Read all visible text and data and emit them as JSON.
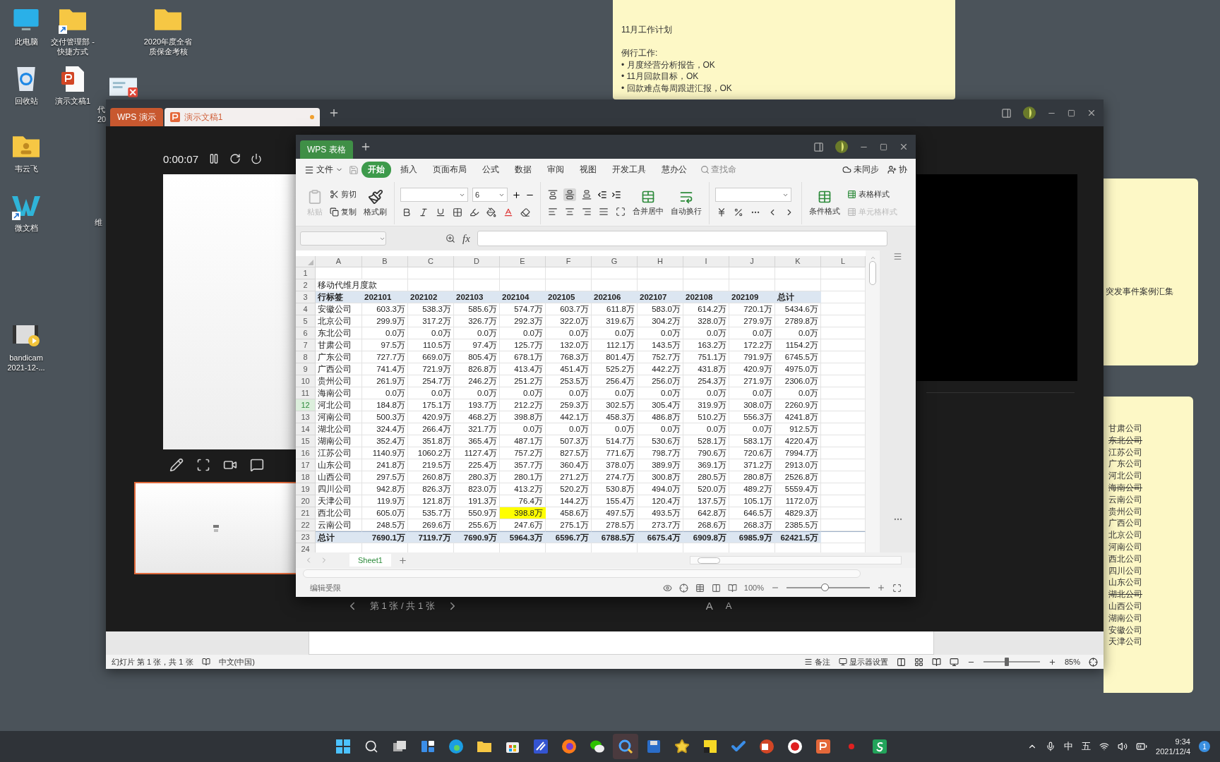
{
  "desktop_icons": [
    {
      "label": "此电脑",
      "kind": "monitor",
      "shortcut": false
    },
    {
      "label": "交付管理部 - 快捷方式",
      "kind": "folder",
      "shortcut": true
    },
    {
      "label": "2020年度全省质保金考核",
      "kind": "folder",
      "shortcut": false
    },
    {
      "label": "回收站",
      "kind": "recycle",
      "shortcut": false
    },
    {
      "label": "演示文稿1",
      "kind": "slides",
      "shortcut": false
    },
    {
      "label": "代\n20",
      "kind": "image",
      "shortcut": false
    },
    {
      "label": "韦云飞",
      "kind": "user-folder",
      "shortcut": false
    },
    {
      "label": "微文档",
      "kind": "w-app",
      "shortcut": true
    },
    {
      "label": "维",
      "kind": "hidden",
      "shortcut": false
    },
    {
      "label": "bandicam 2021-12-...",
      "kind": "video",
      "shortcut": false
    }
  ],
  "sticky_notes": [
    {
      "kind": "plan",
      "title": "11月工作计划",
      "lines": [
        {
          "text": "例行工作:",
          "struck": false
        },
        {
          "text": "• 月度经营分析报告，OK",
          "struck": false
        },
        {
          "text": "• 11月回款目标，OK",
          "struck": false
        },
        {
          "text": "• 回款难点每周跟进汇报，OK",
          "struck": false
        }
      ]
    },
    {
      "kind": "side",
      "lines": [
        {
          "text": "突发事件案例汇集",
          "struck": false
        }
      ]
    },
    {
      "kind": "list",
      "lines": [
        {
          "text": "甘肃公司",
          "struck": false
        },
        {
          "text": "东北公司",
          "struck": true
        },
        {
          "text": "江苏公司",
          "struck": false
        },
        {
          "text": "广东公司",
          "struck": false
        },
        {
          "text": "河北公司",
          "struck": false
        },
        {
          "text": "海南公司",
          "struck": true
        },
        {
          "text": "云南公司",
          "struck": false
        },
        {
          "text": "贵州公司",
          "struck": false
        },
        {
          "text": "广西公司",
          "struck": false
        },
        {
          "text": "北京公司",
          "struck": false
        },
        {
          "text": "河南公司",
          "struck": false
        },
        {
          "text": "西北公司",
          "struck": false
        },
        {
          "text": "四川公司",
          "struck": false
        },
        {
          "text": "山东公司",
          "struck": false
        },
        {
          "text": "湖北公司",
          "struck": true
        },
        {
          "text": "山西公司",
          "struck": false
        },
        {
          "text": "湖南公司",
          "struck": false
        },
        {
          "text": "安徽公司",
          "struck": false
        },
        {
          "text": "天津公司",
          "struck": false
        }
      ]
    }
  ],
  "presentation_window": {
    "app_tab": "WPS 演示",
    "doc_tabs": [
      {
        "label": "演示文稿1",
        "selected": true,
        "unsaved": true
      }
    ],
    "timer": "0:00:07",
    "slide_nav": "第 1 张 / 共 1 张",
    "font_buttons": [
      "A",
      "A"
    ],
    "status_bar": {
      "slide_info": "幻灯片 第 1 张，共 1 张",
      "language": "中文(中国)",
      "notes": "备注",
      "display_settings": "显示器设置",
      "zoom": "85%",
      "zoom_level": {
        "level": 0.41
      }
    }
  },
  "spreadsheet_window": {
    "app_tab": "WPS 表格",
    "menu": [
      {
        "label": "开始",
        "selected": true
      },
      {
        "label": "插入",
        "selected": false
      },
      {
        "label": "页面布局",
        "selected": false
      },
      {
        "label": "公式",
        "selected": false
      },
      {
        "label": "数据",
        "selected": false
      },
      {
        "label": "审阅",
        "selected": false
      },
      {
        "label": "视图",
        "selected": false
      },
      {
        "label": "开发工具",
        "selected": false
      },
      {
        "label": "慧办公",
        "selected": false
      }
    ],
    "file_menu": "文件",
    "search": "查找命",
    "sync": "未同步",
    "collab": "协",
    "ribbon": {
      "paste": {
        "label": "粘贴",
        "disabled": true
      },
      "cut": "剪切",
      "copy": "复制",
      "format_painter": "格式刷",
      "font_size": "6",
      "merge": "合并居中",
      "wrap": "自动换行",
      "conditional": "条件格式",
      "table_style": "表格样式",
      "cell_style": {
        "label": "单元格样式",
        "disabled": true
      },
      "vertical_align": [
        {
          "kind": "top",
          "selected": false
        },
        {
          "kind": "middle",
          "selected": true
        },
        {
          "kind": "bottom",
          "selected": false
        }
      ]
    },
    "fx_label": "fx",
    "sheet": {
      "columns": [
        "A",
        "B",
        "C",
        "D",
        "E",
        "F",
        "G",
        "H",
        "I",
        "J",
        "K",
        "L"
      ],
      "rows": [
        {
          "number": "1",
          "kind": "empty",
          "selected": false
        },
        {
          "number": "2",
          "kind": "title",
          "selected": false,
          "cells": [
            "移动代维月度款"
          ]
        },
        {
          "number": "3",
          "kind": "header",
          "selected": false,
          "cells": [
            "行标签",
            "202101",
            "202102",
            "202103",
            "202104",
            "202105",
            "202106",
            "202107",
            "202108",
            "202109",
            "总计"
          ]
        },
        {
          "number": "4",
          "kind": "data",
          "selected": false,
          "cells": [
            "安徽公司",
            "603.3万",
            "538.3万",
            "585.6万",
            "574.7万",
            "603.7万",
            "611.8万",
            "583.0万",
            "614.2万",
            "720.1万",
            "5434.6万"
          ],
          "highlighted": [
            false,
            false,
            false,
            false,
            false,
            false,
            false,
            false,
            false,
            false,
            false
          ]
        },
        {
          "number": "5",
          "kind": "data",
          "selected": false,
          "cells": [
            "北京公司",
            "299.9万",
            "317.2万",
            "326.7万",
            "292.3万",
            "322.0万",
            "319.6万",
            "304.2万",
            "328.0万",
            "279.9万",
            "2789.8万"
          ],
          "highlighted": [
            false,
            false,
            false,
            false,
            false,
            false,
            false,
            false,
            false,
            false,
            false
          ]
        },
        {
          "number": "6",
          "kind": "data",
          "selected": false,
          "cells": [
            "东北公司",
            "0.0万",
            "0.0万",
            "0.0万",
            "0.0万",
            "0.0万",
            "0.0万",
            "0.0万",
            "0.0万",
            "0.0万",
            "0.0万"
          ],
          "highlighted": [
            false,
            false,
            false,
            false,
            false,
            false,
            false,
            false,
            false,
            false,
            false
          ]
        },
        {
          "number": "7",
          "kind": "data",
          "selected": false,
          "cells": [
            "甘肃公司",
            "97.5万",
            "110.5万",
            "97.4万",
            "125.7万",
            "132.0万",
            "112.1万",
            "143.5万",
            "163.2万",
            "172.2万",
            "1154.2万"
          ],
          "highlighted": [
            false,
            false,
            false,
            false,
            false,
            false,
            false,
            false,
            false,
            false,
            false
          ]
        },
        {
          "number": "8",
          "kind": "data",
          "selected": false,
          "cells": [
            "广东公司",
            "727.7万",
            "669.0万",
            "805.4万",
            "678.1万",
            "768.3万",
            "801.4万",
            "752.7万",
            "751.1万",
            "791.9万",
            "6745.5万"
          ],
          "highlighted": [
            false,
            false,
            false,
            false,
            false,
            false,
            false,
            false,
            false,
            false,
            false
          ]
        },
        {
          "number": "9",
          "kind": "data",
          "selected": false,
          "cells": [
            "广西公司",
            "741.4万",
            "721.9万",
            "826.8万",
            "413.4万",
            "451.4万",
            "525.2万",
            "442.2万",
            "431.8万",
            "420.9万",
            "4975.0万"
          ],
          "highlighted": [
            false,
            false,
            false,
            false,
            false,
            false,
            false,
            false,
            false,
            false,
            false
          ]
        },
        {
          "number": "10",
          "kind": "data",
          "selected": false,
          "cells": [
            "贵州公司",
            "261.9万",
            "254.7万",
            "246.2万",
            "251.2万",
            "253.5万",
            "256.4万",
            "256.0万",
            "254.3万",
            "271.9万",
            "2306.0万"
          ],
          "highlighted": [
            false,
            false,
            false,
            false,
            false,
            false,
            false,
            false,
            false,
            false,
            false
          ]
        },
        {
          "number": "11",
          "kind": "data",
          "selected": false,
          "cells": [
            "海南公司",
            "0.0万",
            "0.0万",
            "0.0万",
            "0.0万",
            "0.0万",
            "0.0万",
            "0.0万",
            "0.0万",
            "0.0万",
            "0.0万"
          ],
          "highlighted": [
            false,
            false,
            false,
            false,
            false,
            false,
            false,
            false,
            false,
            false,
            false
          ]
        },
        {
          "number": "12",
          "kind": "data",
          "selected": true,
          "cells": [
            "河北公司",
            "184.8万",
            "175.1万",
            "193.7万",
            "212.2万",
            "259.3万",
            "302.5万",
            "305.4万",
            "319.9万",
            "308.0万",
            "2260.9万"
          ],
          "highlighted": [
            false,
            false,
            false,
            false,
            false,
            false,
            false,
            false,
            false,
            false,
            false
          ]
        },
        {
          "number": "13",
          "kind": "data",
          "selected": false,
          "cells": [
            "河南公司",
            "500.3万",
            "420.9万",
            "468.2万",
            "398.8万",
            "442.1万",
            "458.3万",
            "486.8万",
            "510.2万",
            "556.3万",
            "4241.8万"
          ],
          "highlighted": [
            false,
            false,
            false,
            false,
            false,
            false,
            false,
            false,
            false,
            false,
            false
          ]
        },
        {
          "number": "14",
          "kind": "data",
          "selected": false,
          "cells": [
            "湖北公司",
            "324.4万",
            "266.4万",
            "321.7万",
            "0.0万",
            "0.0万",
            "0.0万",
            "0.0万",
            "0.0万",
            "0.0万",
            "912.5万"
          ],
          "highlighted": [
            false,
            false,
            false,
            false,
            false,
            false,
            false,
            false,
            false,
            false,
            false
          ]
        },
        {
          "number": "15",
          "kind": "data",
          "selected": false,
          "cells": [
            "湖南公司",
            "352.4万",
            "351.8万",
            "365.4万",
            "487.1万",
            "507.3万",
            "514.7万",
            "530.6万",
            "528.1万",
            "583.1万",
            "4220.4万"
          ],
          "highlighted": [
            false,
            false,
            false,
            false,
            false,
            false,
            false,
            false,
            false,
            false,
            false
          ]
        },
        {
          "number": "16",
          "kind": "data",
          "selected": false,
          "cells": [
            "江苏公司",
            "1140.9万",
            "1060.2万",
            "1127.4万",
            "757.2万",
            "827.5万",
            "771.6万",
            "798.7万",
            "790.6万",
            "720.6万",
            "7994.7万"
          ],
          "highlighted": [
            false,
            false,
            false,
            false,
            false,
            false,
            false,
            false,
            false,
            false,
            false
          ]
        },
        {
          "number": "17",
          "kind": "data",
          "selected": false,
          "cells": [
            "山东公司",
            "241.8万",
            "219.5万",
            "225.4万",
            "357.7万",
            "360.4万",
            "378.0万",
            "389.9万",
            "369.1万",
            "371.2万",
            "2913.0万"
          ],
          "highlighted": [
            false,
            false,
            false,
            false,
            false,
            false,
            false,
            false,
            false,
            false,
            false
          ]
        },
        {
          "number": "18",
          "kind": "data",
          "selected": false,
          "cells": [
            "山西公司",
            "297.5万",
            "260.8万",
            "280.3万",
            "280.1万",
            "271.2万",
            "274.7万",
            "300.8万",
            "280.5万",
            "280.8万",
            "2526.8万"
          ],
          "highlighted": [
            false,
            false,
            false,
            false,
            false,
            false,
            false,
            false,
            false,
            false,
            false
          ]
        },
        {
          "number": "19",
          "kind": "data",
          "selected": false,
          "cells": [
            "四川公司",
            "942.8万",
            "826.3万",
            "823.0万",
            "413.2万",
            "520.2万",
            "530.8万",
            "494.0万",
            "520.0万",
            "489.2万",
            "5559.4万"
          ],
          "highlighted": [
            false,
            false,
            false,
            false,
            false,
            false,
            false,
            false,
            false,
            false,
            false
          ]
        },
        {
          "number": "20",
          "kind": "data",
          "selected": false,
          "cells": [
            "天津公司",
            "119.9万",
            "121.8万",
            "191.3万",
            "76.4万",
            "144.2万",
            "155.4万",
            "120.4万",
            "137.5万",
            "105.1万",
            "1172.0万"
          ],
          "highlighted": [
            false,
            false,
            false,
            false,
            false,
            false,
            false,
            false,
            false,
            false,
            false
          ]
        },
        {
          "number": "21",
          "kind": "data",
          "selected": false,
          "cells": [
            "西北公司",
            "605.0万",
            "535.7万",
            "550.9万",
            "398.8万",
            "458.6万",
            "497.5万",
            "493.5万",
            "642.8万",
            "646.5万",
            "4829.3万"
          ],
          "highlighted": [
            false,
            false,
            false,
            false,
            true,
            false,
            false,
            false,
            false,
            false,
            false
          ]
        },
        {
          "number": "22",
          "kind": "data",
          "selected": false,
          "cells": [
            "云南公司",
            "248.5万",
            "269.6万",
            "255.6万",
            "247.6万",
            "275.1万",
            "278.5万",
            "273.7万",
            "268.6万",
            "268.3万",
            "2385.5万"
          ],
          "highlighted": [
            false,
            false,
            false,
            false,
            false,
            false,
            false,
            false,
            false,
            false,
            false
          ]
        },
        {
          "number": "23",
          "kind": "total",
          "selected": false,
          "cells": [
            "总计",
            "7690.1万",
            "7119.7万",
            "7690.9万",
            "5964.3万",
            "6596.7万",
            "6788.5万",
            "6675.4万",
            "6909.8万",
            "6985.9万",
            "62421.5万"
          ]
        },
        {
          "number": "24",
          "kind": "empty",
          "selected": false
        }
      ]
    },
    "sheet_tabs": [
      {
        "label": "Sheet1",
        "selected": true
      }
    ],
    "status_bar": {
      "mode": "编辑受限",
      "zoom": "100%",
      "zoom_level": {
        "level": 0.46
      }
    }
  },
  "taskbar": {
    "apps": [
      {
        "kind": "start",
        "selected": false
      },
      {
        "kind": "search",
        "selected": false
      },
      {
        "kind": "taskview",
        "selected": false
      },
      {
        "kind": "widgets",
        "selected": false
      },
      {
        "kind": "edge",
        "selected": false
      },
      {
        "kind": "folder",
        "selected": false
      },
      {
        "kind": "store",
        "selected": false
      },
      {
        "kind": "pen",
        "selected": false
      },
      {
        "kind": "firefox",
        "selected": false
      },
      {
        "kind": "chat",
        "selected": false
      },
      {
        "kind": "magnifier",
        "selected": true
      },
      {
        "kind": "disk",
        "selected": false
      },
      {
        "kind": "star",
        "selected": false
      },
      {
        "kind": "note",
        "selected": false
      },
      {
        "kind": "check",
        "selected": false
      },
      {
        "kind": "slides",
        "selected": false
      },
      {
        "kind": "record",
        "selected": false
      },
      {
        "kind": "wps",
        "selected": false
      },
      {
        "kind": "dot",
        "selected": false
      },
      {
        "kind": "sheet",
        "selected": false
      }
    ],
    "ime": [
      "中",
      "五"
    ],
    "time": "9:34",
    "date": "2021/12/4",
    "badge": "1"
  }
}
